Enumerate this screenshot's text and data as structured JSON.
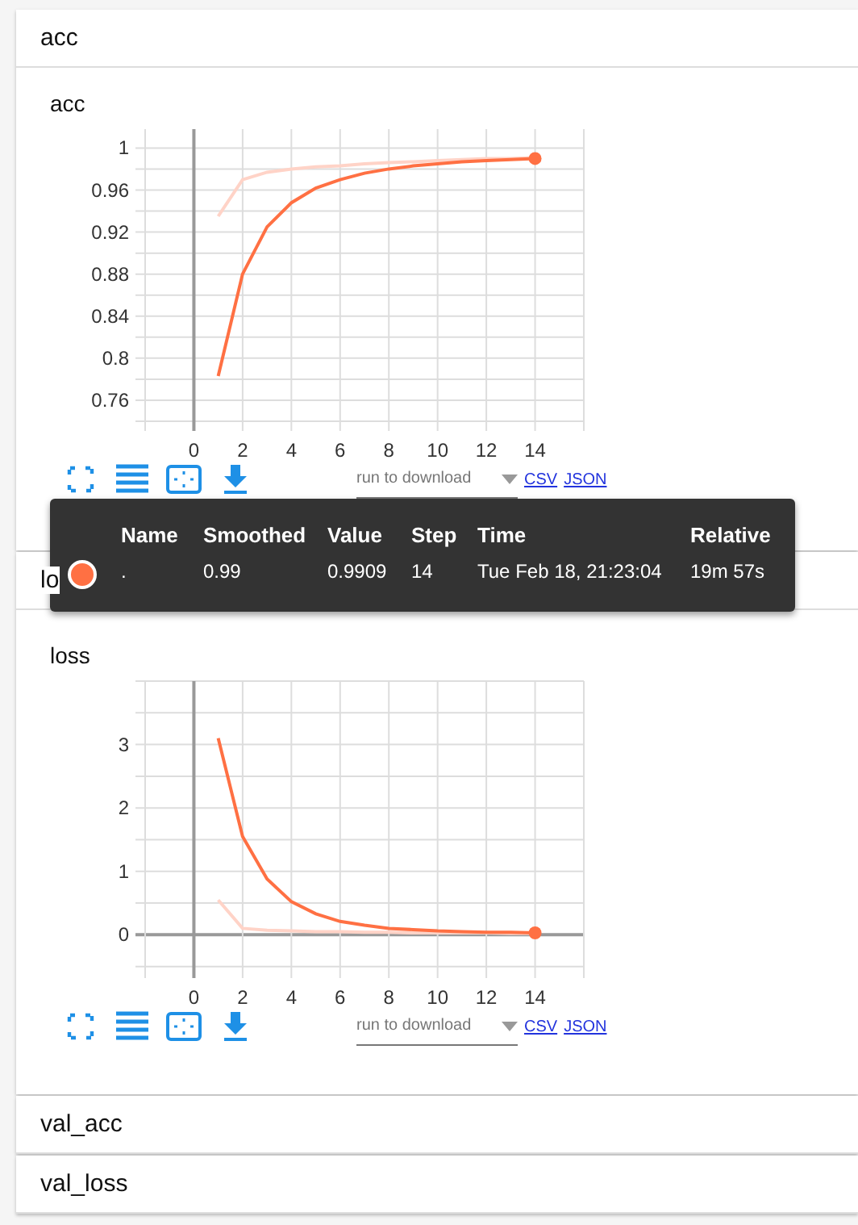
{
  "sections": [
    {
      "title": "acc",
      "card": {
        "title": "acc",
        "chart_data": {
          "type": "line",
          "grid": true,
          "x": [
            1,
            2,
            3,
            4,
            5,
            6,
            7,
            8,
            9,
            10,
            11,
            12,
            13,
            14
          ],
          "xlim": [
            -2,
            16
          ],
          "ylim": [
            0.74,
            1.018
          ],
          "xticks": [
            0,
            2,
            4,
            6,
            8,
            10,
            12,
            14
          ],
          "yticks": [
            0.76,
            0.8,
            0.84,
            0.88,
            0.92,
            0.96,
            1
          ],
          "series": [
            {
              "color": "#ffd3c7",
              "values": [
                0.935,
                0.97,
                0.977,
                0.98,
                0.982,
                0.983,
                0.985,
                0.986,
                0.987,
                0.988,
                0.989,
                0.99,
                0.99,
                0.991
              ]
            },
            {
              "color": "#ff7043",
              "values": [
                0.783,
                0.88,
                0.925,
                0.948,
                0.962,
                0.97,
                0.976,
                0.98,
                0.983,
                0.985,
                0.987,
                0.988,
                0.989,
                0.99
              ]
            }
          ]
        },
        "run_select": {
          "placeholder": "run to download"
        },
        "links": [
          "CSV",
          "JSON"
        ]
      }
    },
    {
      "title": "lo",
      "card": {
        "title": "loss",
        "chart_data": {
          "type": "line",
          "grid": true,
          "x": [
            1,
            2,
            3,
            4,
            5,
            6,
            7,
            8,
            9,
            10,
            11,
            12,
            13,
            14
          ],
          "xlim": [
            -2,
            16
          ],
          "ylim": [
            -0.53,
            4
          ],
          "xticks": [
            0,
            2,
            4,
            6,
            8,
            10,
            12,
            14
          ],
          "yticks": [
            0,
            1,
            2,
            3
          ],
          "series": [
            {
              "color": "#ffd3c7",
              "values": [
                0.55,
                0.1,
                0.07,
                0.06,
                0.05,
                0.05,
                0.04,
                0.04,
                0.03,
                0.03,
                0.03,
                0.03,
                0.02,
                0.02
              ]
            },
            {
              "color": "#ff7043",
              "values": [
                3.1,
                1.55,
                0.88,
                0.52,
                0.33,
                0.21,
                0.15,
                0.1,
                0.08,
                0.06,
                0.05,
                0.04,
                0.04,
                0.03
              ]
            }
          ]
        },
        "run_select": {
          "placeholder": "run to download"
        },
        "links": [
          "CSV",
          "JSON"
        ]
      }
    },
    {
      "title": "val_acc"
    },
    {
      "title": "val_loss"
    }
  ],
  "tooltip": {
    "columns": [
      "Name",
      "Smoothed",
      "Value",
      "Step",
      "Time",
      "Relative"
    ],
    "rows": [
      {
        "color": "#ff7043",
        "cells": [
          ".",
          "0.99",
          "0.9909",
          "14",
          "Tue Feb 18, 21:23:04",
          "19m 57s"
        ]
      }
    ]
  }
}
